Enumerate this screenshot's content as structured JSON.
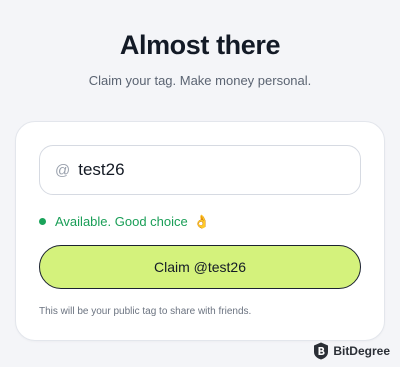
{
  "header": {
    "title": "Almost there",
    "subtitle": "Claim your tag. Make money personal."
  },
  "tag_form": {
    "at_symbol": "@",
    "input_value": "test26",
    "availability": {
      "text": "Available. Good choice",
      "emoji": "👌",
      "status_color": "#1aa35a"
    },
    "claim_label": "Claim @test26",
    "claim_color": "#d4f27c",
    "hint": "This will be your public tag to share with friends."
  },
  "watermark": {
    "text": "BitDegree",
    "icon": "bitdegree-logo-icon"
  }
}
